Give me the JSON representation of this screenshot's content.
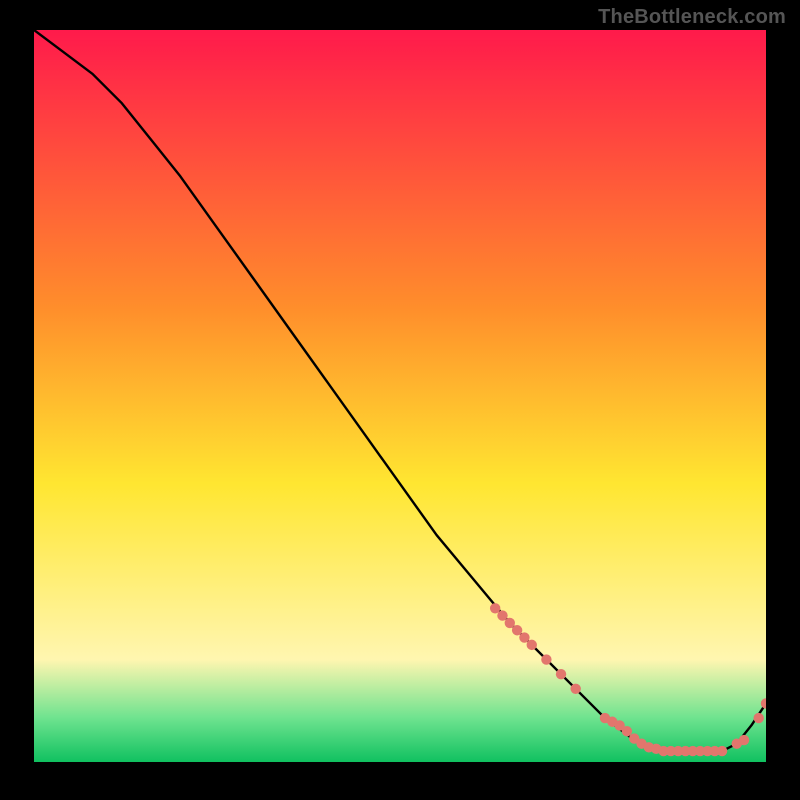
{
  "watermark": "TheBottleneck.com",
  "colors": {
    "background": "#000000",
    "watermark_text": "#555555",
    "line": "#000000",
    "marker": "#e2766d",
    "grad_top": "#ff1a4b",
    "grad_mid1": "#ff8e2b",
    "grad_mid2": "#ffe631",
    "grad_mid3": "#fff6b0",
    "grad_bottom_green1": "#6ee38f",
    "grad_bottom_green2": "#10c160"
  },
  "chart_data": {
    "type": "line",
    "title": "",
    "xlabel": "",
    "ylabel": "",
    "xlim": [
      0,
      100
    ],
    "ylim": [
      0,
      100
    ],
    "grid": false,
    "legend": false,
    "line": {
      "x": [
        0,
        4,
        8,
        12,
        16,
        20,
        25,
        30,
        35,
        40,
        45,
        50,
        55,
        60,
        65,
        70,
        74,
        78,
        82,
        84,
        86,
        88,
        90,
        92,
        94,
        96,
        98,
        100
      ],
      "y": [
        100,
        97,
        94,
        90,
        85,
        80,
        73,
        66,
        59,
        52,
        45,
        38,
        31,
        25,
        19,
        14,
        10,
        6,
        3,
        2,
        1.5,
        1.5,
        1.5,
        1.5,
        1.5,
        2.5,
        5,
        8
      ]
    },
    "markers": {
      "x": [
        63,
        64,
        65,
        66,
        67,
        68,
        70,
        72,
        74,
        78,
        79,
        80,
        81,
        82,
        83,
        84,
        85,
        86,
        87,
        88,
        89,
        90,
        91,
        92,
        93,
        94,
        96,
        97,
        99,
        100
      ],
      "y": [
        21,
        20,
        19,
        18,
        17,
        16,
        14,
        12,
        10,
        6,
        5.5,
        5.0,
        4.2,
        3.2,
        2.5,
        2.0,
        1.8,
        1.5,
        1.5,
        1.5,
        1.5,
        1.5,
        1.5,
        1.5,
        1.5,
        1.5,
        2.5,
        3.0,
        6.0,
        8.0
      ]
    }
  }
}
